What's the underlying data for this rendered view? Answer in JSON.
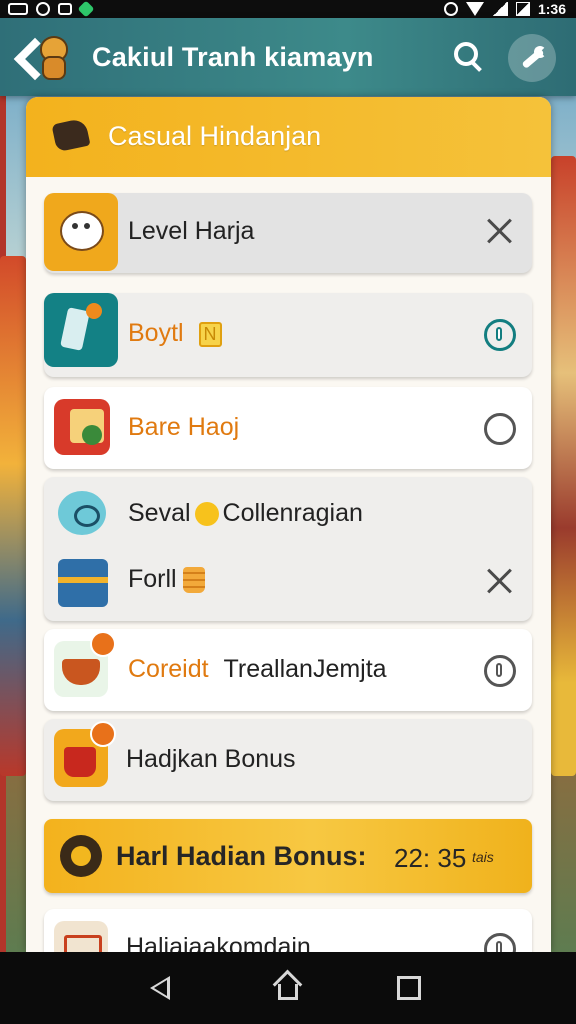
{
  "status_bar": {
    "time": "1:36",
    "icons": [
      "notification-icon",
      "circle-icon",
      "lock-icon",
      "gem-icon",
      "alarm-icon",
      "wifi-icon",
      "signal-icon",
      "battery-icon"
    ]
  },
  "app_bar": {
    "title": "Cakiul Tranh kiamayn",
    "icons": [
      "back-arrow-icon",
      "mascot-icon",
      "search-icon",
      "wrench-icon"
    ]
  },
  "panel": {
    "title": "Casual Hindanjan",
    "icon": "chef-hat-icon",
    "items": [
      {
        "label": "Level Harja",
        "icon": "rice-bowl-icon",
        "action": "close",
        "style": "grey"
      },
      {
        "label": "Boytl",
        "tag": "N",
        "icon": "drink-cup-icon",
        "action": "radio-teal",
        "style": "soft",
        "label_color": "#e07a10"
      },
      {
        "label": "Bare Haoj",
        "icon": "food-basket-icon",
        "action": "radio",
        "style": "white",
        "label_color": "#e07a10"
      },
      {
        "label": "Seval",
        "label_suffix": "Collenragian",
        "icon": "fish-icon",
        "action": "none",
        "style": "soft"
      },
      {
        "label": "Forll",
        "icon": "treasure-box-icon",
        "action": "close",
        "style": "soft"
      },
      {
        "label": "Coreidt",
        "label_suffix": "Treallan​Jemjta",
        "icon": "soup-bowl-icon",
        "action": "radio",
        "style": "white",
        "label_color": "#e07a10"
      },
      {
        "label": "Hadjkan Bonus",
        "icon": "bonus-cup-icon",
        "action": "none",
        "style": "soft"
      }
    ],
    "bonus_bar": {
      "label": "Harl Hadian Bonus:",
      "time": "22: 35",
      "suffix": "tais",
      "icon": "gear-icon"
    },
    "last_item": {
      "label": "Haliaiaakomdain",
      "icon": "cart-icon",
      "action": "radio"
    }
  },
  "nav_bar": {
    "icons": [
      "nav-back-icon",
      "nav-home-icon",
      "nav-recents-icon"
    ]
  },
  "colors": {
    "accent": "#f3b21d",
    "app_bar": "#3d8a8a",
    "orange_label": "#e07a10",
    "teal": "#137e80"
  }
}
